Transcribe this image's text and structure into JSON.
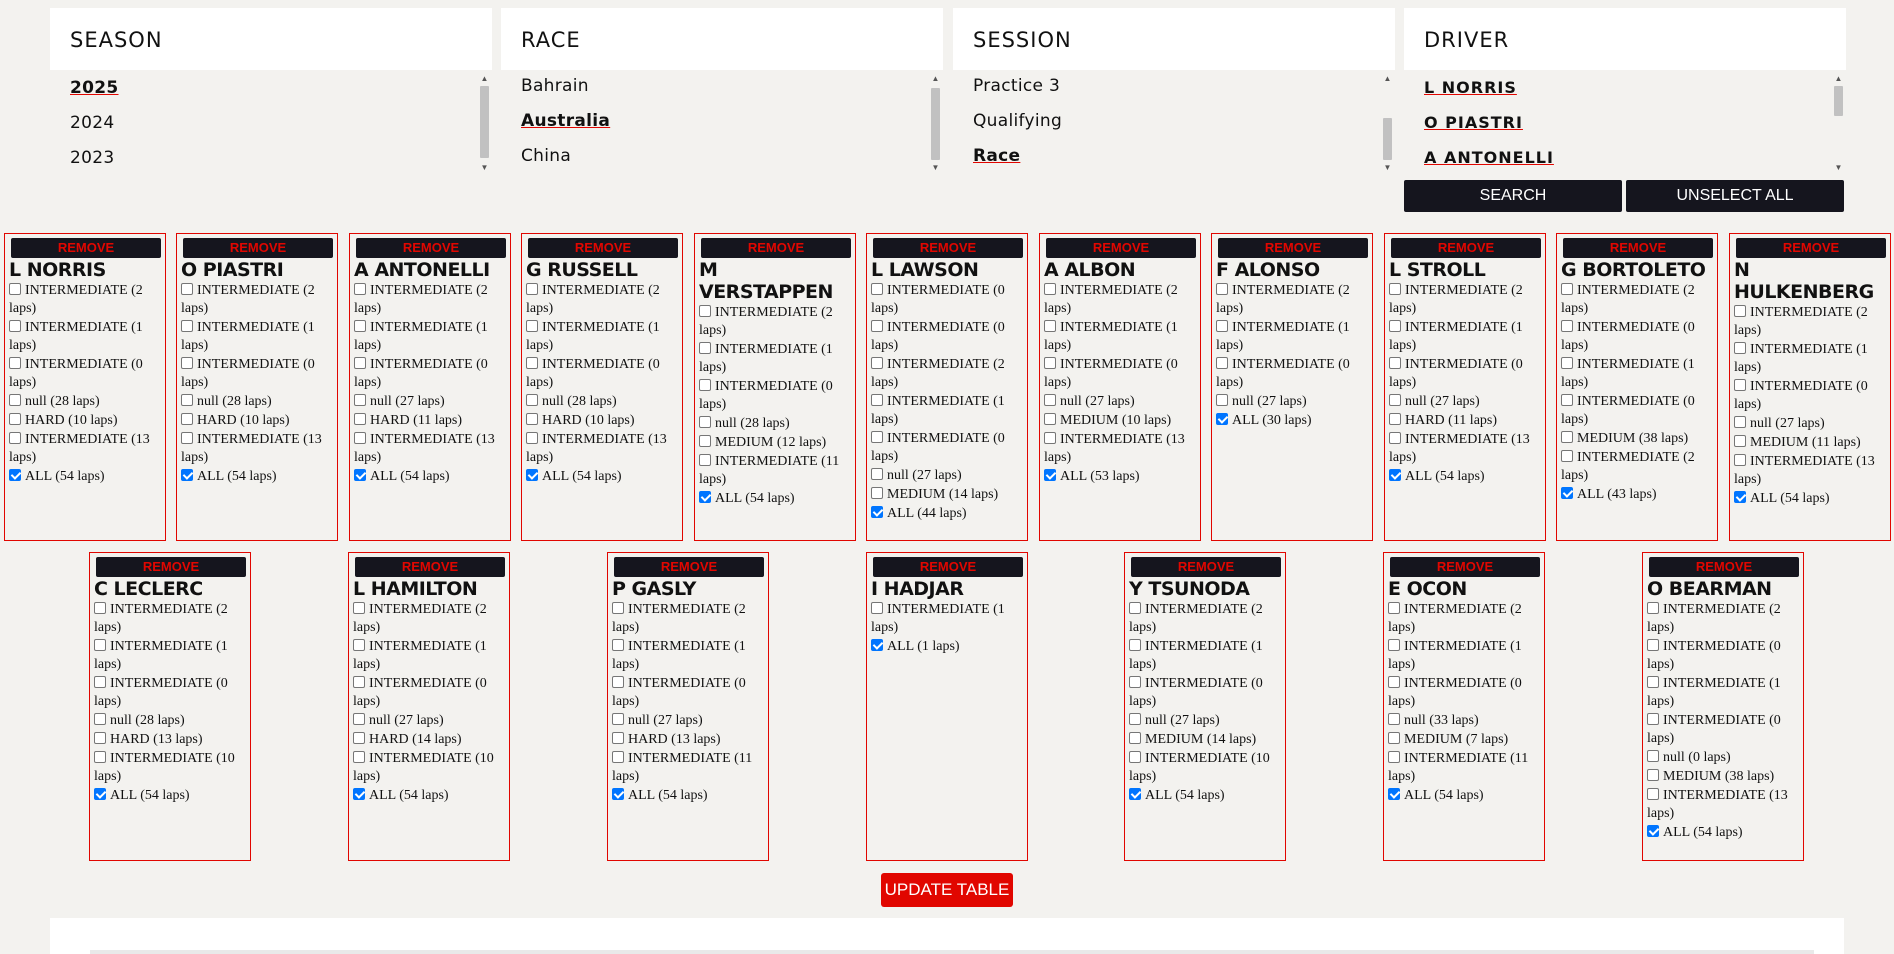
{
  "panels": {
    "season": {
      "title": "SEASON",
      "options": [
        "2025",
        "2024",
        "2023"
      ],
      "selected": 0
    },
    "race": {
      "title": "RACE",
      "options": [
        "Bahrain",
        "Australia",
        "China"
      ],
      "selected": 1
    },
    "session": {
      "title": "SESSION",
      "options": [
        "Practice 3",
        "Qualifying",
        "Race"
      ],
      "selected": 2
    },
    "driver": {
      "title": "DRIVER",
      "options": [
        "L NORRIS",
        "O PIASTRI",
        "A ANTONELLI"
      ]
    }
  },
  "buttons": {
    "search": "SEARCH",
    "unselect": "UNSELECT ALL",
    "update": "UPDATE TABLE",
    "remove": "REMOVE"
  },
  "colors": {
    "accent": "#e10600",
    "dark": "#15151e",
    "checkbox": "#0075ff"
  },
  "drivers": [
    {
      "name": "L NORRIS",
      "stints": [
        [
          "INTERMEDIATE (2 laps)",
          false
        ],
        [
          "INTERMEDIATE (1 laps)",
          false
        ],
        [
          "INTERMEDIATE (0 laps)",
          false
        ],
        [
          "null (28 laps)",
          false
        ],
        [
          "HARD (10 laps)",
          false
        ],
        [
          "INTERMEDIATE (13 laps)",
          false
        ],
        [
          "ALL (54 laps)",
          true
        ]
      ]
    },
    {
      "name": "O PIASTRI",
      "stints": [
        [
          "INTERMEDIATE (2 laps)",
          false
        ],
        [
          "INTERMEDIATE (1 laps)",
          false
        ],
        [
          "INTERMEDIATE (0 laps)",
          false
        ],
        [
          "null (28 laps)",
          false
        ],
        [
          "HARD (10 laps)",
          false
        ],
        [
          "INTERMEDIATE (13 laps)",
          false
        ],
        [
          "ALL (54 laps)",
          true
        ]
      ]
    },
    {
      "name": "A ANTONELLI",
      "stints": [
        [
          "INTERMEDIATE (2 laps)",
          false
        ],
        [
          "INTERMEDIATE (1 laps)",
          false
        ],
        [
          "INTERMEDIATE (0 laps)",
          false
        ],
        [
          "null (27 laps)",
          false
        ],
        [
          "HARD (11 laps)",
          false
        ],
        [
          "INTERMEDIATE (13 laps)",
          false
        ],
        [
          "ALL (54 laps)",
          true
        ]
      ]
    },
    {
      "name": "G RUSSELL",
      "stints": [
        [
          "INTERMEDIATE (2 laps)",
          false
        ],
        [
          "INTERMEDIATE (1 laps)",
          false
        ],
        [
          "INTERMEDIATE (0 laps)",
          false
        ],
        [
          "null (28 laps)",
          false
        ],
        [
          "HARD (10 laps)",
          false
        ],
        [
          "INTERMEDIATE (13 laps)",
          false
        ],
        [
          "ALL (54 laps)",
          true
        ]
      ]
    },
    {
      "name": "M VERSTAPPEN",
      "stints": [
        [
          "INTERMEDIATE (2 laps)",
          false
        ],
        [
          "INTERMEDIATE (1 laps)",
          false
        ],
        [
          "INTERMEDIATE (0 laps)",
          false
        ],
        [
          "null (28 laps)",
          false
        ],
        [
          "MEDIUM (12 laps)",
          false
        ],
        [
          "INTERMEDIATE (11 laps)",
          false
        ],
        [
          "ALL (54 laps)",
          true
        ]
      ]
    },
    {
      "name": "L LAWSON",
      "stints": [
        [
          "INTERMEDIATE (0 laps)",
          false
        ],
        [
          "INTERMEDIATE (0 laps)",
          false
        ],
        [
          "INTERMEDIATE (2 laps)",
          false
        ],
        [
          "INTERMEDIATE (1 laps)",
          false
        ],
        [
          "INTERMEDIATE (0 laps)",
          false
        ],
        [
          "null (27 laps)",
          false
        ],
        [
          "MEDIUM (14 laps)",
          false
        ],
        [
          "ALL (44 laps)",
          true
        ]
      ]
    },
    {
      "name": "A ALBON",
      "stints": [
        [
          "INTERMEDIATE (2 laps)",
          false
        ],
        [
          "INTERMEDIATE (1 laps)",
          false
        ],
        [
          "INTERMEDIATE (0 laps)",
          false
        ],
        [
          "null (27 laps)",
          false
        ],
        [
          "MEDIUM (10 laps)",
          false
        ],
        [
          "INTERMEDIATE (13 laps)",
          false
        ],
        [
          "ALL (53 laps)",
          true
        ]
      ]
    },
    {
      "name": "F ALONSO",
      "stints": [
        [
          "INTERMEDIATE (2 laps)",
          false
        ],
        [
          "INTERMEDIATE (1 laps)",
          false
        ],
        [
          "INTERMEDIATE (0 laps)",
          false
        ],
        [
          "null (27 laps)",
          false
        ],
        [
          "ALL (30 laps)",
          true
        ]
      ]
    },
    {
      "name": "L STROLL",
      "stints": [
        [
          "INTERMEDIATE (2 laps)",
          false
        ],
        [
          "INTERMEDIATE (1 laps)",
          false
        ],
        [
          "INTERMEDIATE (0 laps)",
          false
        ],
        [
          "null (27 laps)",
          false
        ],
        [
          "HARD (11 laps)",
          false
        ],
        [
          "INTERMEDIATE (13 laps)",
          false
        ],
        [
          "ALL (54 laps)",
          true
        ]
      ]
    },
    {
      "name": "G BORTOLETO",
      "stints": [
        [
          "INTERMEDIATE (2 laps)",
          false
        ],
        [
          "INTERMEDIATE (0 laps)",
          false
        ],
        [
          "INTERMEDIATE (1 laps)",
          false
        ],
        [
          "INTERMEDIATE (0 laps)",
          false
        ],
        [
          "MEDIUM (38 laps)",
          false
        ],
        [
          "INTERMEDIATE (2 laps)",
          false
        ],
        [
          "ALL (43 laps)",
          true
        ]
      ]
    },
    {
      "name": "N HULKENBERG",
      "stints": [
        [
          "INTERMEDIATE (2 laps)",
          false
        ],
        [
          "INTERMEDIATE (1 laps)",
          false
        ],
        [
          "INTERMEDIATE (0 laps)",
          false
        ],
        [
          "null (27 laps)",
          false
        ],
        [
          "MEDIUM (11 laps)",
          false
        ],
        [
          "INTERMEDIATE (13 laps)",
          false
        ],
        [
          "ALL (54 laps)",
          true
        ]
      ]
    },
    {
      "name": "C LECLERC",
      "stints": [
        [
          "INTERMEDIATE (2 laps)",
          false
        ],
        [
          "INTERMEDIATE (1 laps)",
          false
        ],
        [
          "INTERMEDIATE (0 laps)",
          false
        ],
        [
          "null (28 laps)",
          false
        ],
        [
          "HARD (13 laps)",
          false
        ],
        [
          "INTERMEDIATE (10 laps)",
          false
        ],
        [
          "ALL (54 laps)",
          true
        ]
      ]
    },
    {
      "name": "L HAMILTON",
      "stints": [
        [
          "INTERMEDIATE (2 laps)",
          false
        ],
        [
          "INTERMEDIATE (1 laps)",
          false
        ],
        [
          "INTERMEDIATE (0 laps)",
          false
        ],
        [
          "null (27 laps)",
          false
        ],
        [
          "HARD (14 laps)",
          false
        ],
        [
          "INTERMEDIATE (10 laps)",
          false
        ],
        [
          "ALL (54 laps)",
          true
        ]
      ]
    },
    {
      "name": "P GASLY",
      "stints": [
        [
          "INTERMEDIATE (2 laps)",
          false
        ],
        [
          "INTERMEDIATE (1 laps)",
          false
        ],
        [
          "INTERMEDIATE (0 laps)",
          false
        ],
        [
          "null (27 laps)",
          false
        ],
        [
          "HARD (13 laps)",
          false
        ],
        [
          "INTERMEDIATE (11 laps)",
          false
        ],
        [
          "ALL (54 laps)",
          true
        ]
      ]
    },
    {
      "name": "I HADJAR",
      "stints": [
        [
          "INTERMEDIATE (1 laps)",
          false
        ],
        [
          "ALL (1 laps)",
          true
        ]
      ]
    },
    {
      "name": "Y TSUNODA",
      "stints": [
        [
          "INTERMEDIATE (2 laps)",
          false
        ],
        [
          "INTERMEDIATE (1 laps)",
          false
        ],
        [
          "INTERMEDIATE (0 laps)",
          false
        ],
        [
          "null (27 laps)",
          false
        ],
        [
          "MEDIUM (14 laps)",
          false
        ],
        [
          "INTERMEDIATE (10 laps)",
          false
        ],
        [
          "ALL (54 laps)",
          true
        ]
      ]
    },
    {
      "name": "E OCON",
      "stints": [
        [
          "INTERMEDIATE (2 laps)",
          false
        ],
        [
          "INTERMEDIATE (1 laps)",
          false
        ],
        [
          "INTERMEDIATE (0 laps)",
          false
        ],
        [
          "null (33 laps)",
          false
        ],
        [
          "MEDIUM (7 laps)",
          false
        ],
        [
          "INTERMEDIATE (11 laps)",
          false
        ],
        [
          "ALL (54 laps)",
          true
        ]
      ]
    },
    {
      "name": "O BEARMAN",
      "stints": [
        [
          "INTERMEDIATE (2 laps)",
          false
        ],
        [
          "INTERMEDIATE (0 laps)",
          false
        ],
        [
          "INTERMEDIATE (1 laps)",
          false
        ],
        [
          "INTERMEDIATE (0 laps)",
          false
        ],
        [
          "null (0 laps)",
          false
        ],
        [
          "MEDIUM (38 laps)",
          false
        ],
        [
          "INTERMEDIATE (13 laps)",
          false
        ],
        [
          "ALL (54 laps)",
          true
        ]
      ]
    }
  ]
}
